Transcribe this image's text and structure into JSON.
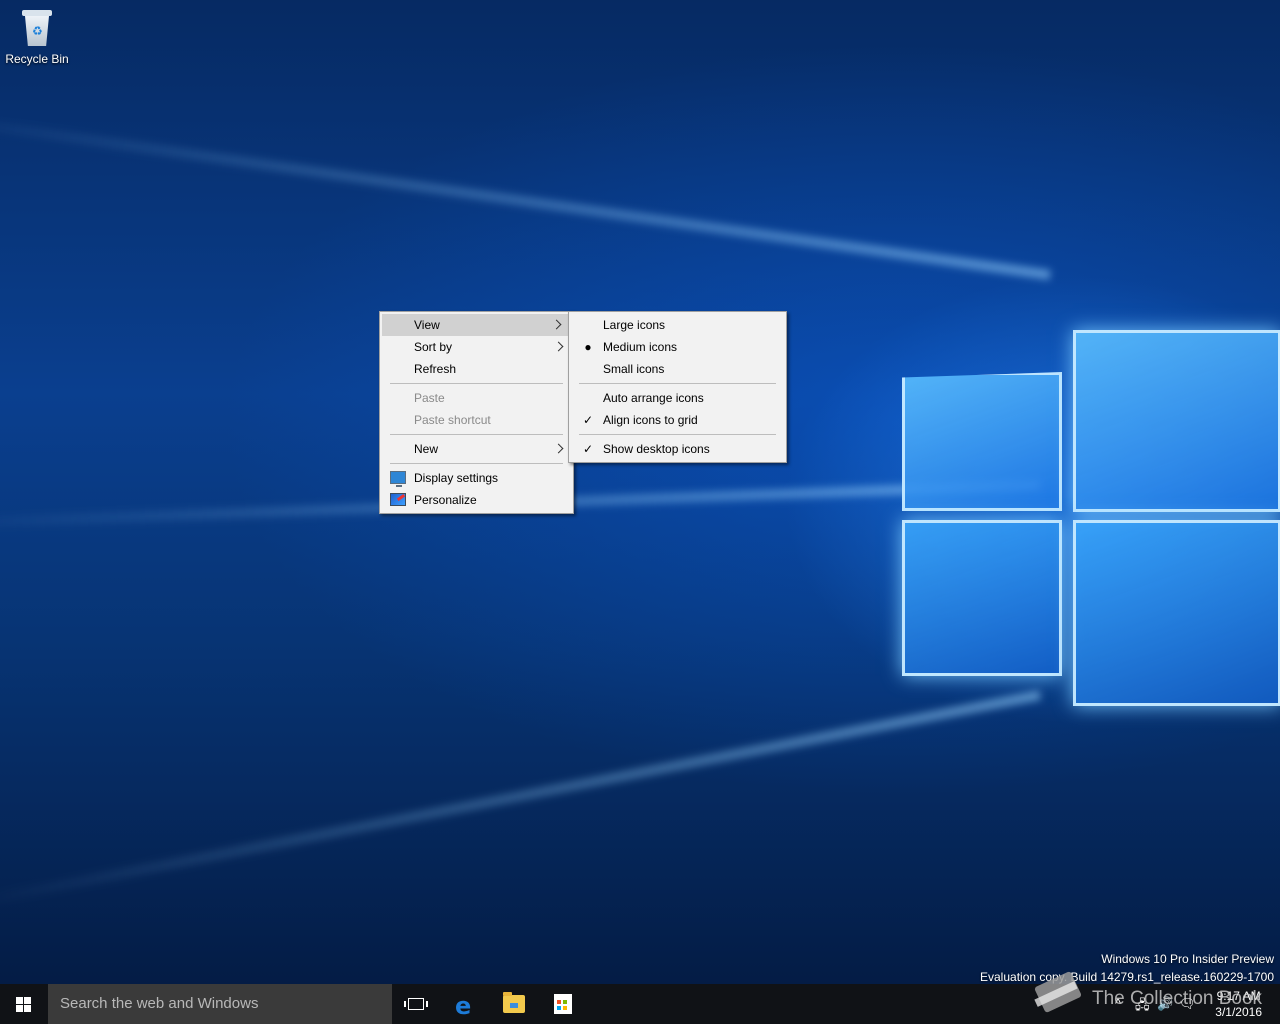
{
  "desktop": {
    "icons": [
      {
        "label": "Recycle Bin",
        "icon": "recycle-bin-icon"
      }
    ],
    "watermark": {
      "line1": "Windows 10 Pro Insider Preview",
      "line2": "Evaluation copy. Build 14279.rs1_release.160229-1700"
    },
    "overlay_text": "The Collection Book"
  },
  "context_menu": {
    "view": "View",
    "sort_by": "Sort by",
    "refresh": "Refresh",
    "paste": "Paste",
    "paste_shortcut": "Paste shortcut",
    "new": "New",
    "display_settings": "Display settings",
    "personalize": "Personalize"
  },
  "view_submenu": {
    "large_icons": "Large icons",
    "medium_icons": "Medium icons",
    "small_icons": "Small icons",
    "auto_arrange": "Auto arrange icons",
    "align_to_grid": "Align icons to grid",
    "show_desktop_icons": "Show desktop icons",
    "selected_size": "Medium icons",
    "checked": [
      "Align icons to grid",
      "Show desktop icons"
    ]
  },
  "taskbar": {
    "search_placeholder": "Search the web and Windows",
    "pinned": [
      "task-view-icon",
      "edge-icon",
      "file-explorer-icon",
      "store-icon"
    ],
    "clock": {
      "time": "9:17 AM",
      "date": "3/1/2016"
    }
  },
  "colors": {
    "taskbar": "#101216",
    "search_box": "#3a3a3a",
    "menu_background": "#f2f2f2",
    "menu_highlight": "#d1d1d1"
  }
}
